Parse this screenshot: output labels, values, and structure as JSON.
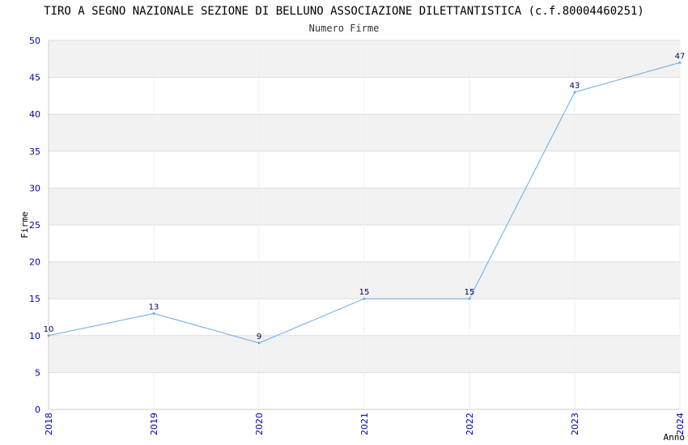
{
  "chart_data": {
    "type": "line",
    "title": "TIRO A SEGNO NAZIONALE SEZIONE DI BELLUNO ASSOCIAZIONE DILETTANTISTICA (c.f.80004460251)",
    "subtitle": "Numero Firme",
    "xlabel": "Anno",
    "ylabel": "Firme",
    "x": [
      "2018",
      "2019",
      "2020",
      "2021",
      "2022",
      "2023",
      "2024"
    ],
    "series": [
      {
        "values": [
          10,
          13,
          9,
          15,
          15,
          43,
          47
        ]
      }
    ],
    "ylim": [
      0,
      50
    ],
    "yticks": [
      0,
      5,
      10,
      15,
      20,
      25,
      30,
      35,
      40,
      45,
      50
    ],
    "grid": true,
    "colors": {
      "line": "#66aaee",
      "band": "#f2f2f2",
      "tick": "#0000aa",
      "label": "#000066"
    }
  }
}
